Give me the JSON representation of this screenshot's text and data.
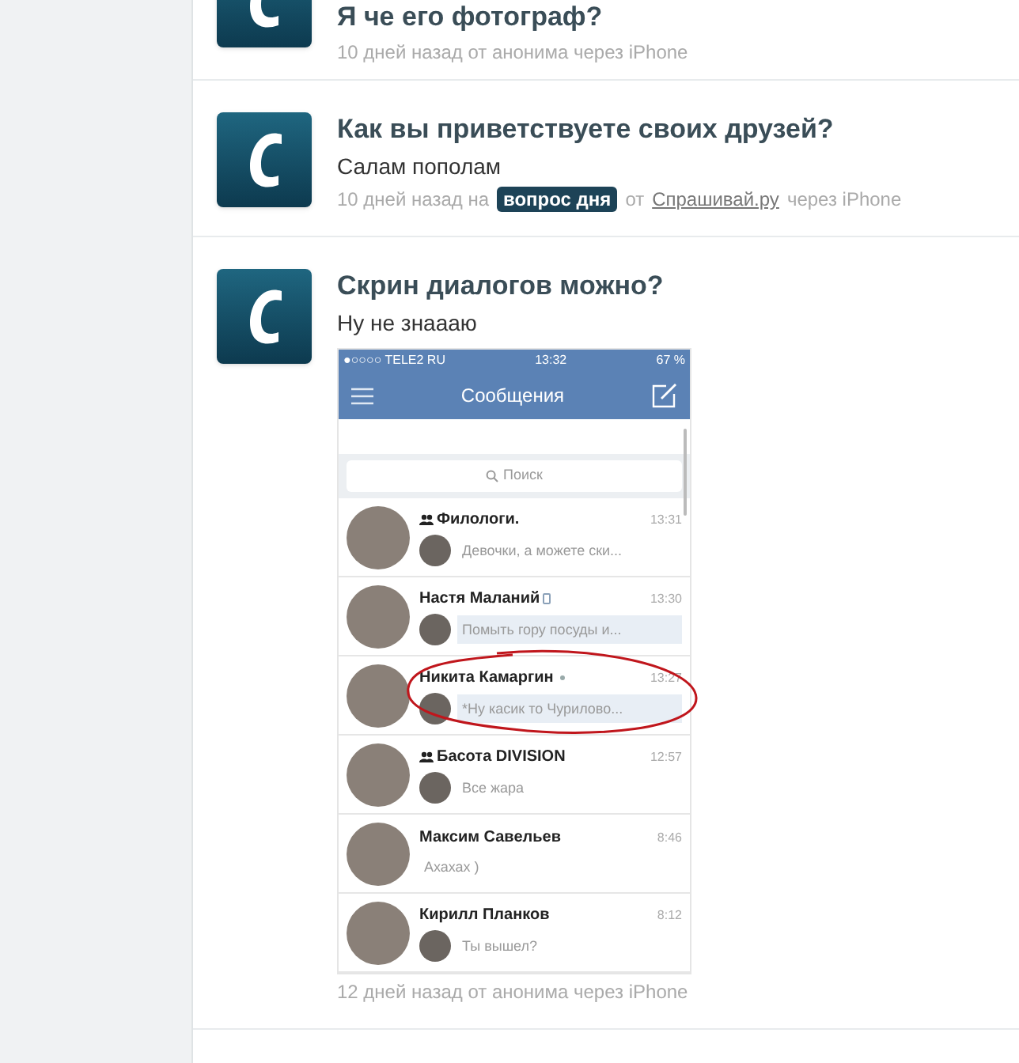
{
  "feed": [
    {
      "question": "Я че его фотограф?",
      "meta": [
        {
          "kind": "text",
          "text": "10 дней назад от анонима через iPhone"
        }
      ]
    },
    {
      "question": "Как вы приветствуете своих друзей?",
      "answer": "Салам пополам",
      "meta": [
        {
          "kind": "text",
          "text": "10 дней назад на"
        },
        {
          "kind": "tag",
          "text": "вопрос дня"
        },
        {
          "kind": "text",
          "text": "от"
        },
        {
          "kind": "link",
          "text": "Спрашивай.ру"
        },
        {
          "kind": "text",
          "text": "через iPhone"
        }
      ]
    },
    {
      "question": "Скрин диалогов можно?",
      "answer": "Ну не знаааю",
      "screenshot": {
        "carrier": "●○○○○ TELE2 RU",
        "time": "13:32",
        "battery": "67 %",
        "title": "Сообщения",
        "search_placeholder": "Поиск",
        "dialogs": [
          {
            "kind": "group",
            "name": "Филологи.",
            "time": "13:31",
            "message": "Девочки, а можете ски...",
            "outgoing": true,
            "unread": false,
            "mobile": false,
            "online": false,
            "circled": false
          },
          {
            "kind": "user",
            "name": "Настя Маланий",
            "time": "13:30",
            "message": "Помыть гору посуды и...",
            "outgoing": true,
            "unread": true,
            "mobile": true,
            "online": false,
            "circled": false
          },
          {
            "kind": "user",
            "name": "Никита Камаргин",
            "time": "13:27",
            "message": "*Ну касик то Чурилово...",
            "outgoing": true,
            "unread": true,
            "mobile": false,
            "online": true,
            "circled": true
          },
          {
            "kind": "group",
            "name": "Басота DIVISION",
            "time": "12:57",
            "message": "Все жара",
            "outgoing": true,
            "unread": false,
            "mobile": false,
            "online": false,
            "circled": false
          },
          {
            "kind": "user",
            "name": "Максим Савельев",
            "time": "8:46",
            "message": "Ахахах )",
            "outgoing": false,
            "unread": false,
            "mobile": false,
            "online": false,
            "circled": false
          },
          {
            "kind": "user",
            "name": "Кирилл Планков",
            "time": "8:12",
            "message": "Ты вышел?",
            "outgoing": true,
            "unread": false,
            "mobile": false,
            "online": false,
            "circled": false
          }
        ]
      },
      "meta": [
        {
          "kind": "text",
          "text": "12 дней назад от анонима через iPhone"
        }
      ]
    }
  ]
}
